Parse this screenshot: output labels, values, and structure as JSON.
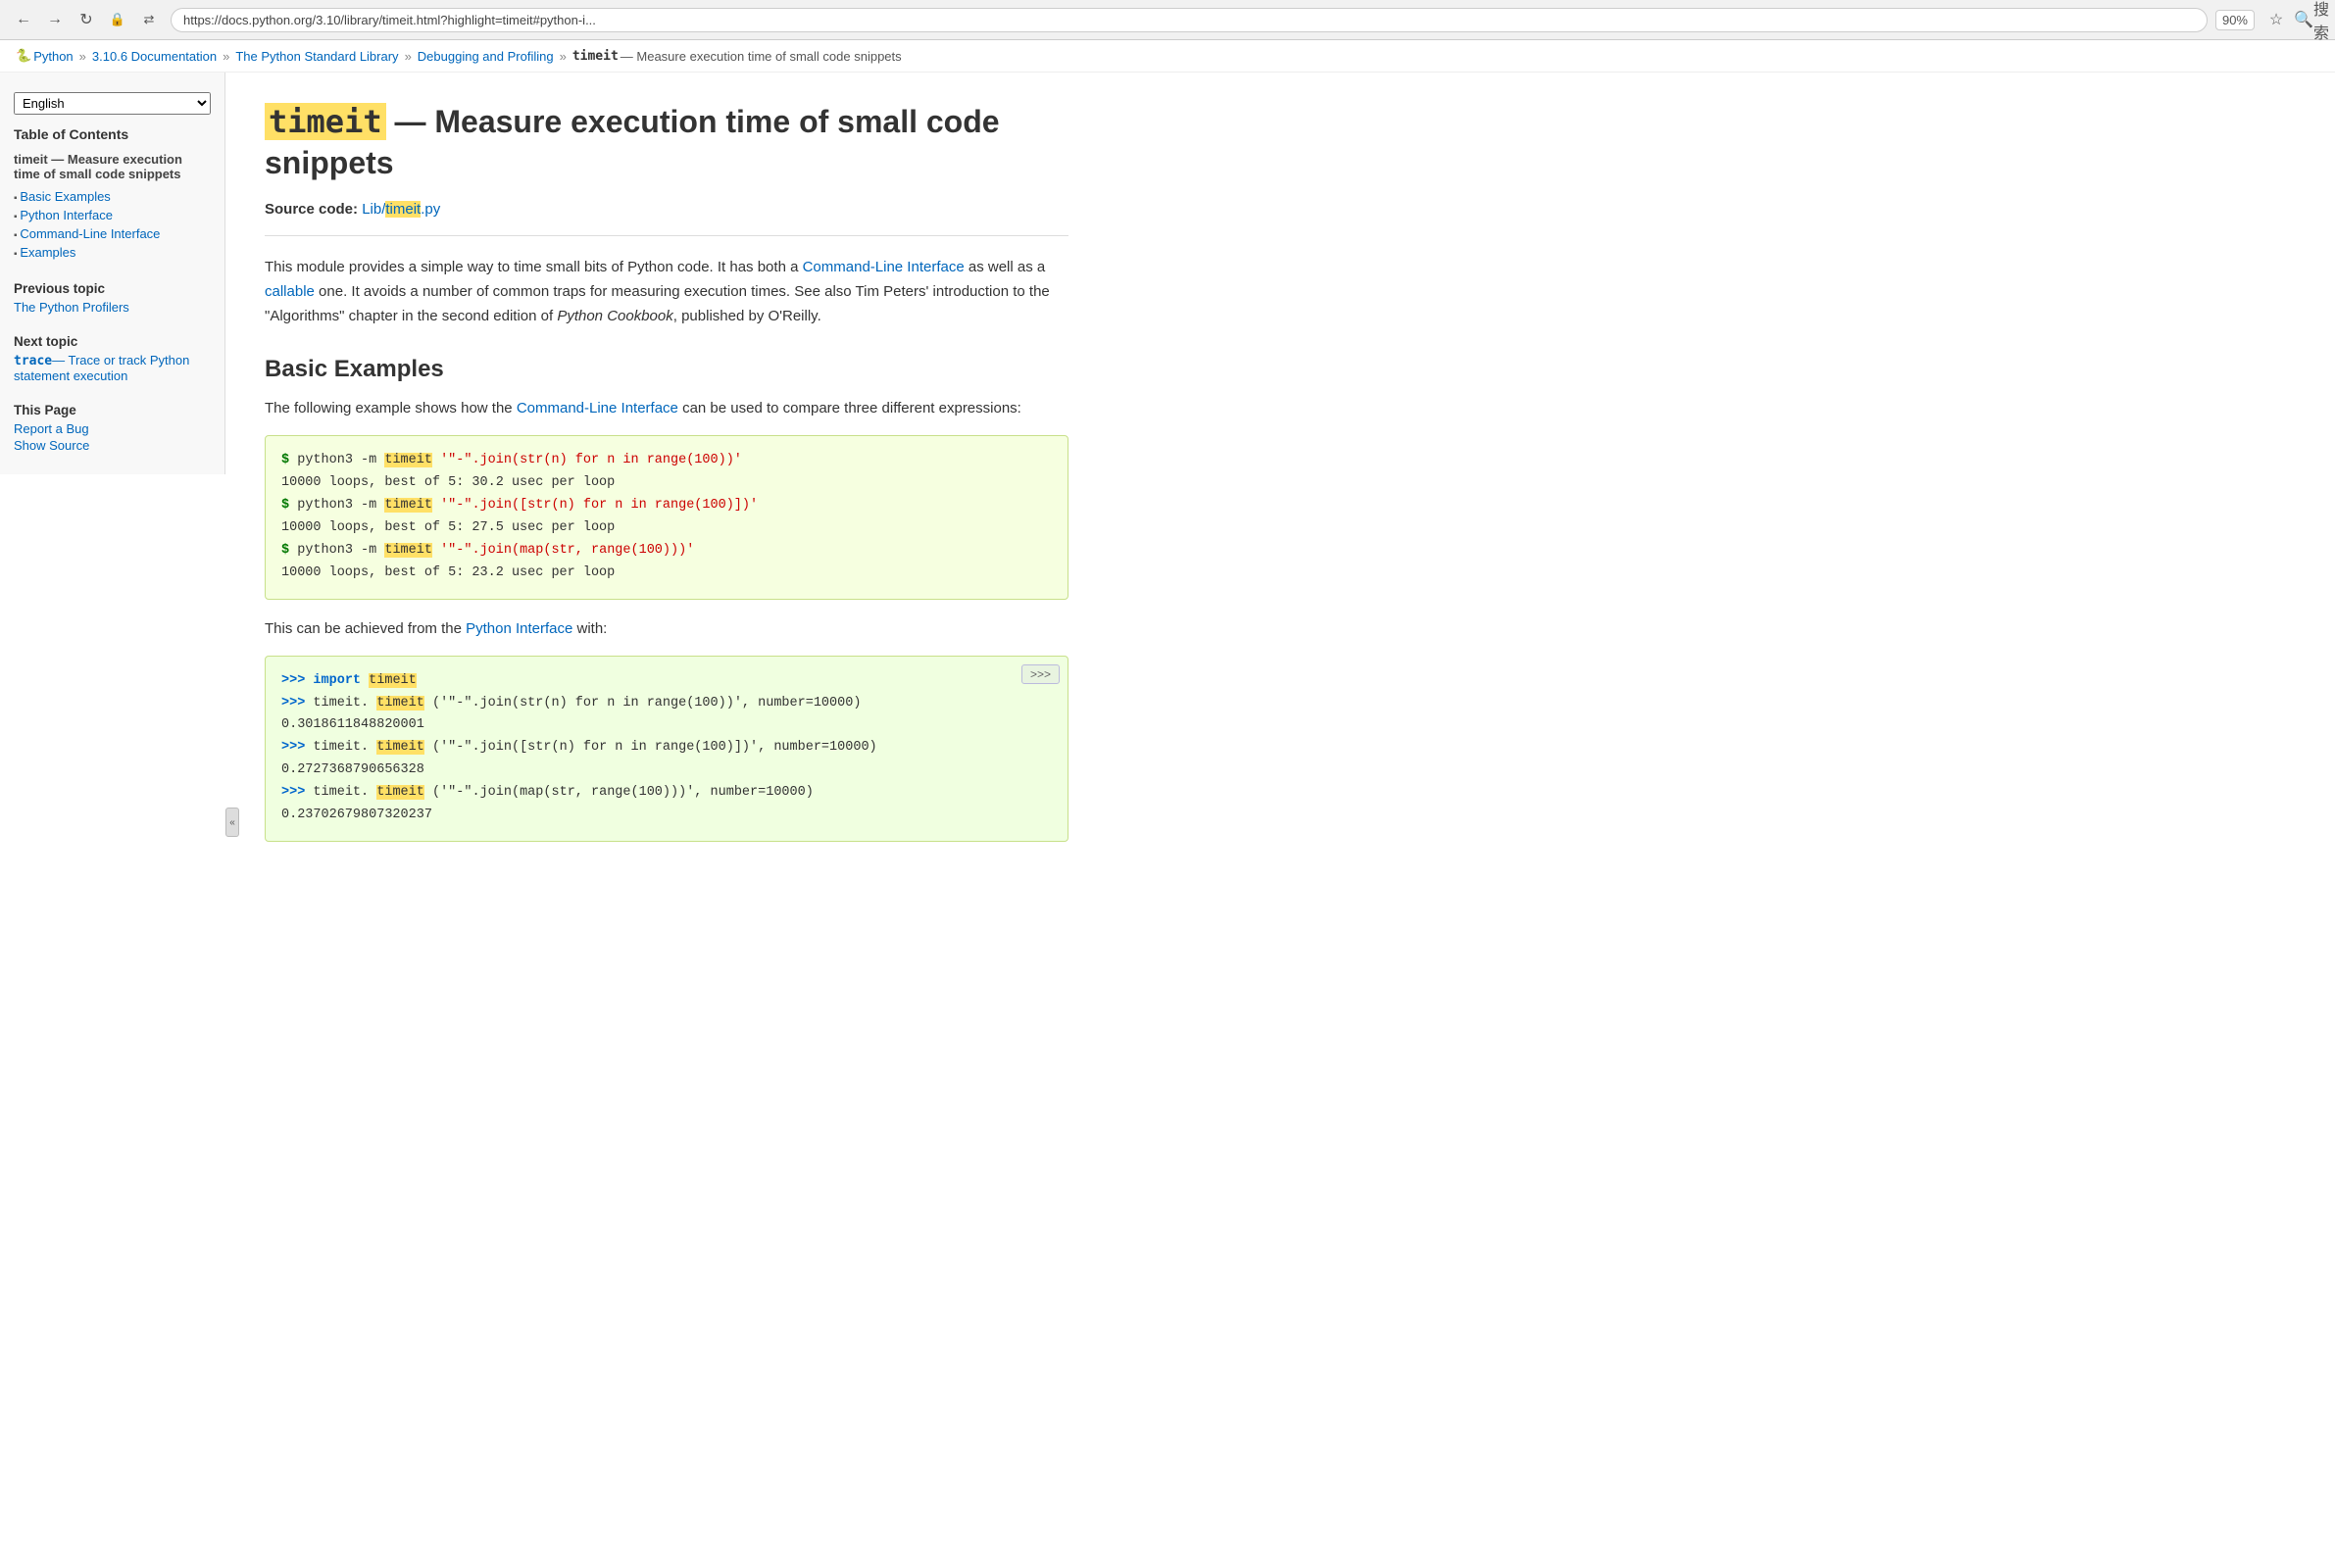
{
  "browser": {
    "url": "https://docs.python.org/3.10/library/timeit.html?highlight=timeit#python-i...",
    "zoom": "90%",
    "search_placeholder": "搜索"
  },
  "breadcrumb": {
    "items": [
      {
        "label": "Python",
        "href": "#"
      },
      {
        "label": "3.10.6 Documentation",
        "href": "#"
      },
      {
        "label": "The Python Standard Library",
        "href": "#"
      },
      {
        "label": "Debugging and Profiling",
        "href": "#"
      },
      {
        "label": "timeit",
        "href": "#",
        "bold": true
      },
      {
        "label": "— Measure execution time of small code snippets",
        "href": null
      }
    ]
  },
  "sidebar": {
    "toc_title": "Table of Contents",
    "toc_main_label": "timeit — Measure execution time of small code snippets",
    "toc_items": [
      {
        "label": "Basic Examples",
        "href": "#"
      },
      {
        "label": "Python Interface",
        "href": "#"
      },
      {
        "label": "Command-Line Interface",
        "href": "#"
      },
      {
        "label": "Examples",
        "href": "#"
      }
    ],
    "prev_section_title": "Previous topic",
    "prev_link_label": "The Python Profilers",
    "next_section_title": "Next topic",
    "next_link_trace": "trace",
    "next_link_desc": "— Trace or track Python statement execution",
    "this_page_title": "This Page",
    "report_bug_label": "Report a Bug",
    "show_source_label": "Show Source"
  },
  "main": {
    "page_title_prefix": "timeit",
    "page_title_suffix": " — Measure execution time of small code snippets",
    "source_code_label": "Source code:",
    "source_code_link": "Lib/timeit.py",
    "source_code_link_prefix": "Lib/",
    "source_code_link_highlighted": "timeit",
    "source_code_link_suffix": ".py",
    "description": "This module provides a simple way to time small bits of Python code. It has both a Command-Line Interface as well as a callable one. It avoids a number of common traps for measuring execution times. See also Tim Peters' introduction to the \"Algorithms\" chapter in the second edition of Python Cookbook, published by O'Reilly.",
    "basic_examples_title": "Basic Examples",
    "basic_examples_intro": "The following example shows how the Command-Line Interface can be used to compare three different expressions:",
    "code_block1": {
      "lines": [
        {
          "type": "command",
          "prompt": "$",
          "cmd": " python3 -m ",
          "highlight": "timeit",
          "arg": " '\"-\".join(str(n) for n in range(100))'"
        },
        {
          "type": "output",
          "text": "10000 loops, best of 5: 30.2 usec per loop"
        },
        {
          "type": "command",
          "prompt": "$",
          "cmd": " python3 -m ",
          "highlight": "timeit",
          "arg": " '\"-\".join([str(n) for n in range(100)])'"
        },
        {
          "type": "output",
          "text": "10000 loops, best of 5: 27.5 usec per loop"
        },
        {
          "type": "command",
          "prompt": "$",
          "cmd": " python3 -m ",
          "highlight": "timeit",
          "arg": " '\"-\".join(map(str, range(100)))'"
        },
        {
          "type": "output",
          "text": "10000 loops, best of 5: 23.2 usec per loop"
        }
      ]
    },
    "python_interface_intro": "This can be achieved from the Python Interface with:",
    "python_interface_link": "Python Interface",
    "code_block2": {
      "lines": [
        {
          "type": "interactive",
          "prompt": ">>>",
          "content": " import ",
          "keyword": "timeit"
        },
        {
          "type": "interactive",
          "prompt": ">>>",
          "content": " timeit.",
          "func": "timeit",
          "args": "('\"-\".join(str(n) for n in range(100))', number=10000)"
        },
        {
          "type": "output",
          "text": "0.3018611848820001"
        },
        {
          "type": "interactive",
          "prompt": ">>>",
          "content": " timeit.",
          "func": "timeit",
          "args": "('\"-\".join([str(n) for n in range(100)])', number=10000)"
        },
        {
          "type": "output",
          "text": "0.2727368790656328"
        },
        {
          "type": "interactive",
          "prompt": ">>>",
          "content": " timeit.",
          "func": "timeit",
          "args": "('\"-\".join(map(str, range(100)))', number=10000)"
        },
        {
          "type": "output",
          "text": "0.23702679807320237"
        }
      ]
    }
  },
  "lang_selector": {
    "selected": "English"
  },
  "version_selector": {
    "selected": "3.10.6"
  }
}
